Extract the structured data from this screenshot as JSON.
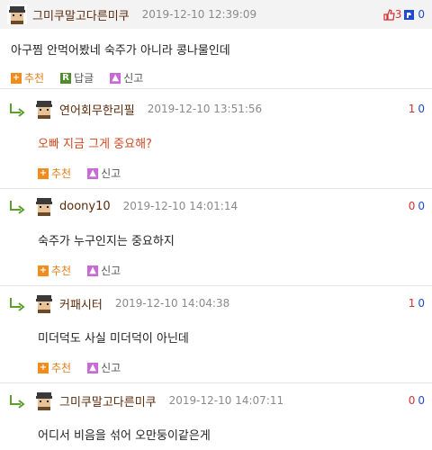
{
  "top": {
    "nick": "그미쿠말고다른미쿠",
    "date": "2019-12-10 12:39:09",
    "up": "3",
    "down": "0",
    "body": "아구찜 안먹어봤네 숙주가 아니라 콩나물인데",
    "recommend_label": "추천",
    "reply_label": "답글",
    "report_label": "신고"
  },
  "replies": [
    {
      "nick": "연어회무한리필",
      "date": "2019-12-10 13:51:56",
      "up": "1",
      "down": "0",
      "body": "오빠 지금 그게 중요해?",
      "recommend_label": "추천",
      "report_label": "신고"
    },
    {
      "nick": "doony10",
      "date": "2019-12-10 14:01:14",
      "up": "0",
      "down": "0",
      "body": "숙주가 누구인지는 중요하지",
      "recommend_label": "추천",
      "report_label": "신고"
    },
    {
      "nick": "커패시터",
      "date": "2019-12-10 14:04:38",
      "up": "1",
      "down": "0",
      "body": "미더덕도 사실 미더덕이 아닌데",
      "recommend_label": "추천",
      "report_label": "신고"
    },
    {
      "nick": "그미쿠말고다른미쿠",
      "date": "2019-12-10 14:07:11",
      "up": "0",
      "down": "0",
      "body": "어디서 비음을 섞어 오만둥이같은게",
      "recommend_label": "추천",
      "report_label": "신고"
    }
  ],
  "colors": {
    "nick": "#5a2a0a",
    "up": "#d32f2f",
    "down": "#1e4bd2",
    "highlight_body": "#d2481f"
  }
}
